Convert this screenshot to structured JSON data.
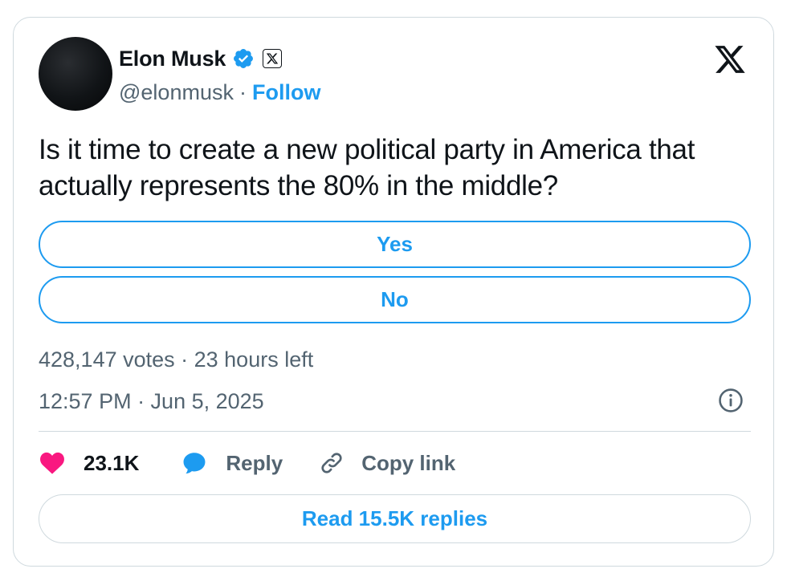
{
  "author": {
    "display_name": "Elon Musk",
    "handle": "@elonmusk",
    "separator": "·",
    "follow_label": "Follow",
    "verified": true,
    "avatar_icon": "profile-photo"
  },
  "tweet": {
    "text": "Is it time to create a new political party in America that actually represents the 80% in the middle?"
  },
  "poll": {
    "options": [
      {
        "label": "Yes"
      },
      {
        "label": "No"
      }
    ],
    "meta": "428,147 votes · 23 hours left"
  },
  "timestamp": "12:57 PM · Jun 5, 2025",
  "actions": {
    "like_count": "23.1K",
    "reply_label": "Reply",
    "copy_link_label": "Copy link"
  },
  "read_replies_label": "Read 15.5K replies",
  "colors": {
    "accent": "#1d9bf0",
    "like": "#f91880",
    "text": "#0f1419",
    "muted": "#536471",
    "border": "#cfd9de"
  },
  "icons": [
    "verified-badge-icon",
    "x-affiliation-icon",
    "x-logo-icon",
    "info-icon",
    "heart-icon",
    "reply-bubble-icon",
    "link-icon"
  ]
}
